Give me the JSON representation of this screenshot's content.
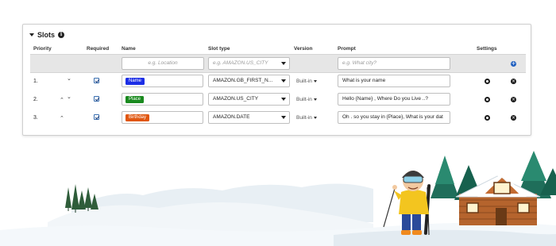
{
  "section": {
    "title": "Slots",
    "info_icon": "info-icon",
    "collapse_icon": "caret-down-icon"
  },
  "columns": {
    "priority": "Priority",
    "required": "Required",
    "name": "Name",
    "slot_type": "Slot type",
    "version": "Version",
    "prompt": "Prompt",
    "settings": "Settings"
  },
  "new_slot": {
    "name_placeholder": "e.g. Location",
    "type_placeholder": "e.g. AMAZON.US_CITY",
    "prompt_placeholder": "e.g. What city?",
    "add_icon": "add-circle-icon"
  },
  "rows": [
    {
      "num": "1.",
      "up": "",
      "down": "⌄",
      "required": true,
      "slot_name": "Name",
      "slot_color": "#1c2ee6",
      "slot_type": "AMAZON.GB_FIRST_N...",
      "version": "Built-in",
      "prompt": "What is your name"
    },
    {
      "num": "2.",
      "up": "⌃",
      "down": "⌄",
      "required": true,
      "slot_name": "Place",
      "slot_color": "#1a8a1f",
      "slot_type": "AMAZON.US_CITY",
      "version": "Built-in",
      "prompt": "Hello {Name} , Where Do you Live ..?"
    },
    {
      "num": "3.",
      "up": "⌃",
      "down": "",
      "required": true,
      "slot_name": "Birthday",
      "slot_color": "#e0560f",
      "slot_type": "AMAZON.DATE",
      "version": "Built-in",
      "prompt": "Oh . so you stay in {Place}, What is your dat"
    }
  ],
  "colors": {
    "accent": "#1f5fbf",
    "panel_bg": "#ffffff",
    "new_row_bg": "#e6e6e6"
  }
}
